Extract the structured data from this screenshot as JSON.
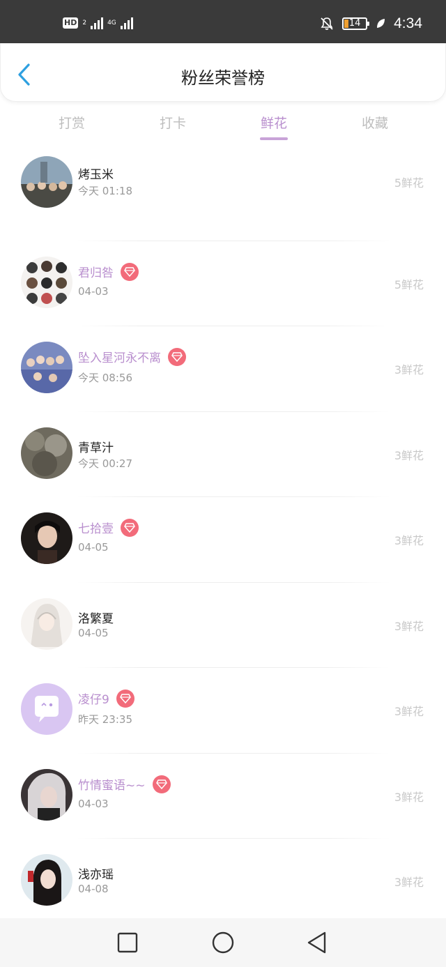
{
  "status_bar": {
    "time": "4:34",
    "battery": "14",
    "network": "4G",
    "hd": "HD",
    "sim": "2"
  },
  "header": {
    "title": "粉丝荣誉榜"
  },
  "tabs": [
    "打赏",
    "打卡",
    "鲜花",
    "收藏"
  ],
  "active_tab": 2,
  "colors": {
    "accent": "#b98fce",
    "badge": "#f26b7a",
    "statusbar": "#3a3a3a"
  },
  "fans": [
    {
      "name": "烤玉米",
      "time": "今天 01:18",
      "count": "5鲜花",
      "vip": false
    },
    {
      "name": "君归咎",
      "time": "04-03",
      "count": "5鲜花",
      "vip": true
    },
    {
      "name": "坠入星河永不离",
      "time": "今天 08:56",
      "count": "3鲜花",
      "vip": true
    },
    {
      "name": "青草汁",
      "time": "今天 00:27",
      "count": "3鲜花",
      "vip": false
    },
    {
      "name": "七拾壹",
      "time": "04-05",
      "count": "3鲜花",
      "vip": true
    },
    {
      "name": "洛繁夏",
      "time": "04-05",
      "count": "3鲜花",
      "vip": false
    },
    {
      "name": "凌仔9",
      "time": "昨天 23:35",
      "count": "3鲜花",
      "vip": true
    },
    {
      "name": "竹情蜜语~~",
      "time": "04-03",
      "count": "3鲜花",
      "vip": true
    },
    {
      "name": "浅亦瑶",
      "time": "04-08",
      "count": "3鲜花",
      "vip": false
    }
  ],
  "icons": {
    "back": "chevron-left-icon",
    "badge": "diamond-icon",
    "nav": [
      "square-icon",
      "circle-icon",
      "triangle-back-icon"
    ]
  }
}
